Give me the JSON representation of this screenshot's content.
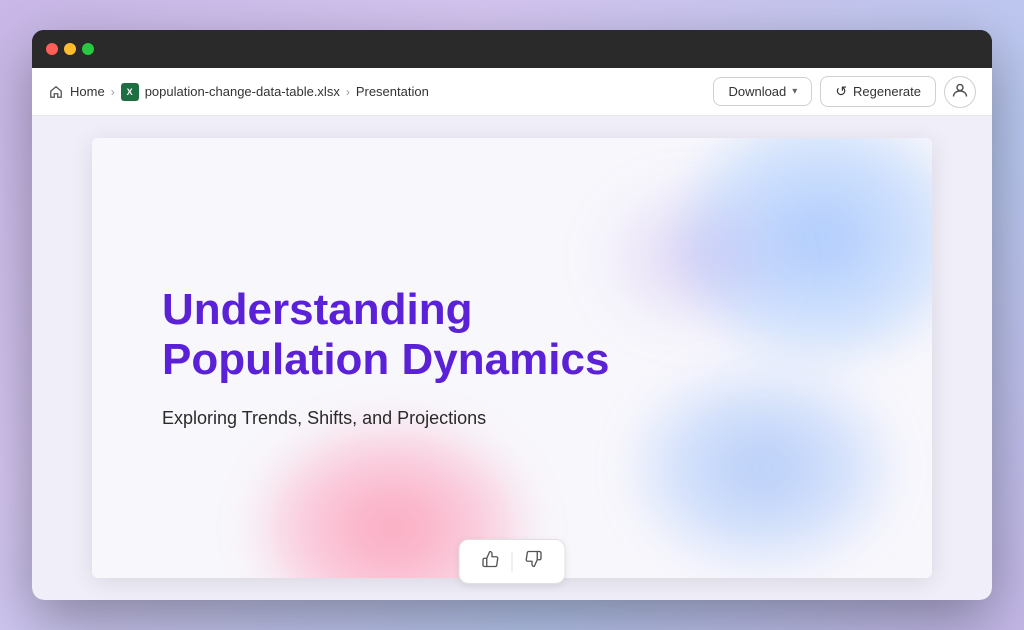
{
  "window": {
    "title": "Presentation"
  },
  "titleBar": {
    "lights": [
      {
        "color": "red",
        "label": "close"
      },
      {
        "color": "yellow",
        "label": "minimize"
      },
      {
        "color": "green",
        "label": "fullscreen"
      }
    ]
  },
  "breadcrumb": {
    "home_label": "Home",
    "file_name": "population-change-data-table.xlsx",
    "file_badge": "X",
    "current_page": "Presentation"
  },
  "toolbar": {
    "download_label": "Download",
    "regenerate_label": "Regenerate",
    "download_chevron": "▾"
  },
  "slide": {
    "title": "Understanding Population Dynamics",
    "subtitle": "Exploring Trends, Shifts, and Projections"
  },
  "feedback": {
    "thumbs_up": "👍",
    "thumbs_down": "👎"
  },
  "icons": {
    "home": "⌂",
    "regenerate": "↺",
    "user": "👤",
    "chevron": "›"
  }
}
